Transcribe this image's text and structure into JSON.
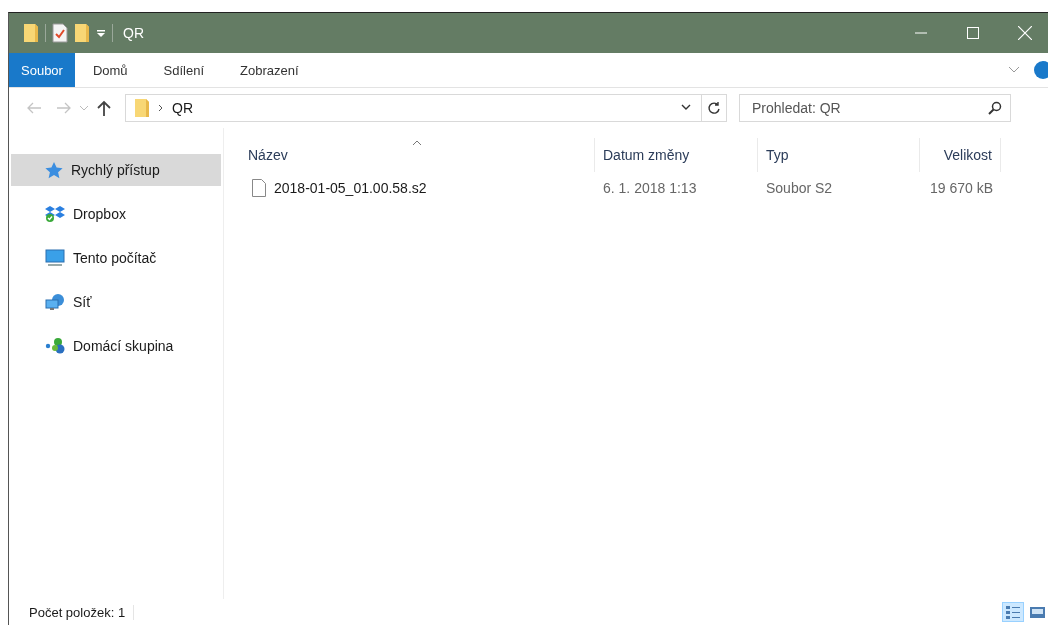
{
  "window": {
    "title": "QR"
  },
  "ribbon_tabs": [
    {
      "label": "Soubor",
      "selected": true
    },
    {
      "label": "Domů",
      "selected": false
    },
    {
      "label": "Sdílení",
      "selected": false
    },
    {
      "label": "Zobrazení",
      "selected": false
    }
  ],
  "navigation": {
    "back_disabled": true,
    "forward_disabled": true
  },
  "address_bar": {
    "path": [
      "QR"
    ]
  },
  "search": {
    "placeholder": "Prohledat: QR"
  },
  "sidebar": {
    "items": [
      {
        "label": "Rychlý přístup",
        "kind": "quick-access",
        "selected": true
      },
      {
        "label": "Dropbox",
        "kind": "dropbox",
        "selected": false
      },
      {
        "label": "Tento počítač",
        "kind": "computer",
        "selected": false
      },
      {
        "label": "Síť",
        "kind": "network",
        "selected": false
      },
      {
        "label": "Domácí skupina",
        "kind": "homegroup",
        "selected": false
      }
    ]
  },
  "table": {
    "columns": [
      {
        "label": "Název",
        "sorted": true
      },
      {
        "label": "Datum změny",
        "sorted": false
      },
      {
        "label": "Typ",
        "sorted": false
      },
      {
        "label": "Velikost",
        "sorted": false
      }
    ],
    "rows": [
      {
        "name": "2018-01-05_01.00.58.s2",
        "date": "6. 1. 2018 1:13",
        "type": "Soubor S2",
        "size": "19 670 kB"
      }
    ]
  },
  "status_bar": {
    "text": "Počet položek: 1"
  },
  "view_buttons": [
    {
      "kind": "details",
      "selected": true
    },
    {
      "kind": "large-icons",
      "selected": false
    }
  ]
}
